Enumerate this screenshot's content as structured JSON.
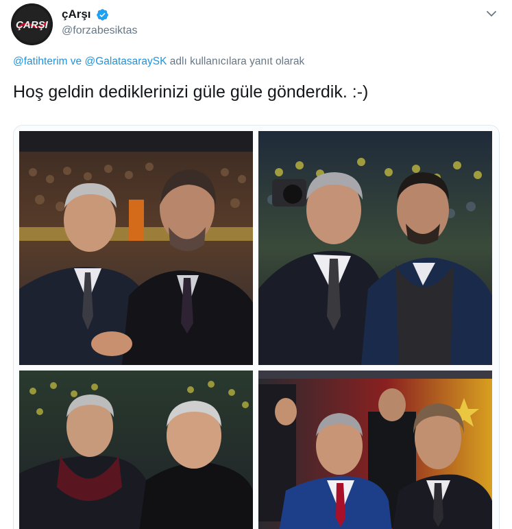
{
  "author": {
    "display_name": "çArşı",
    "handle": "@forzabesiktas",
    "avatar_icon": "carsi-logo-avatar",
    "verified": true,
    "verified_color": "#1da1f2"
  },
  "reply": {
    "mention_1": "@fatihterim",
    "connector": "ve",
    "mention_2": "@GalatasaraySK",
    "suffix": "adlı kullanıcılara yanıt olarak"
  },
  "tweet": {
    "text": "Hoş geldin dediklerinizi güle güle gönderdik. :-)"
  },
  "media": {
    "photos": [
      {
        "name": "photo-top-left"
      },
      {
        "name": "photo-top-right"
      },
      {
        "name": "photo-bottom-left"
      },
      {
        "name": "photo-bottom-right"
      }
    ]
  },
  "colors": {
    "link": "#1b95e0",
    "secondary_text": "#657786",
    "primary_text": "#14171a",
    "border": "#e1e8ed"
  },
  "icons": {
    "caret": "chevron-down-icon",
    "verified": "verified-badge-icon"
  }
}
